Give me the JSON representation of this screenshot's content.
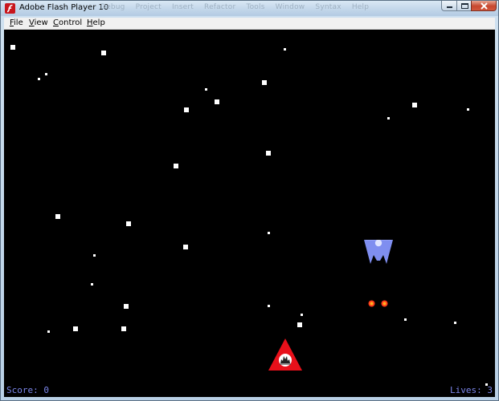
{
  "window": {
    "title": "Adobe Flash Player 10",
    "background_menu_labels": [
      "Debug",
      "Project",
      "Insert",
      "Refactor",
      "Tools",
      "Window",
      "Syntax",
      "Help"
    ]
  },
  "menu": {
    "file": {
      "accel": "F",
      "rest": "ile"
    },
    "view": {
      "accel": "V",
      "rest": "iew"
    },
    "control": {
      "accel": "C",
      "rest": "ontrol"
    },
    "help": {
      "accel": "H",
      "rest": "elp"
    }
  },
  "hud": {
    "score_text": "Score: 0",
    "lives_text": "Lives: 3"
  },
  "colors": {
    "background": "#000000",
    "hud_text": "#7b86ea",
    "player": "#e8101a",
    "enemy": "#7f8ef0",
    "enemy_bullet": "#ff3a1a",
    "star": "#ffffff"
  },
  "icons": {
    "app": "flash-player-icon",
    "minimize": "minimize-icon",
    "maximize": "maximize-icon",
    "close": "close-icon"
  }
}
